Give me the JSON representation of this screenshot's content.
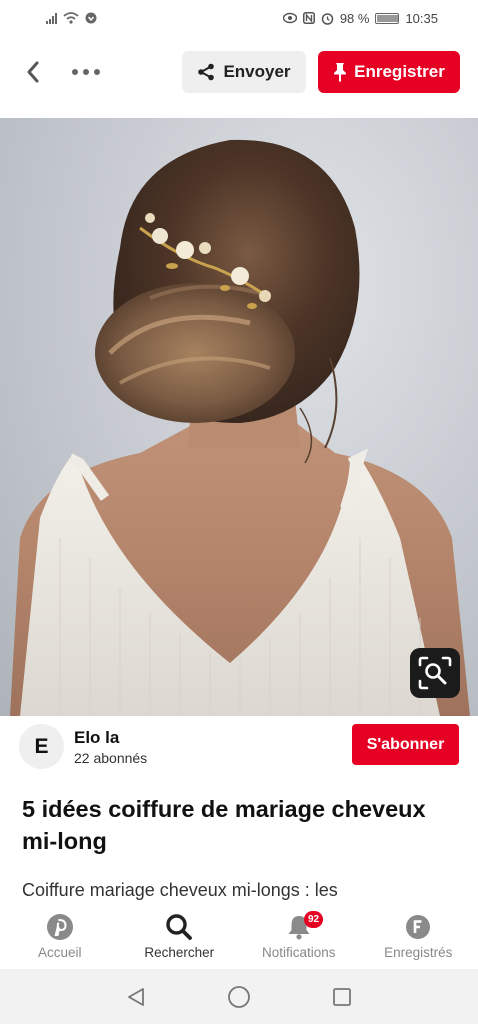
{
  "status_bar": {
    "battery": "98 %",
    "time": "10:35"
  },
  "top_bar": {
    "send_label": "Envoyer",
    "save_label": "Enregistrer"
  },
  "creator": {
    "avatar_letter": "E",
    "name": "Elo la",
    "followers": "22 abonnés",
    "follow_label": "S'abonner"
  },
  "pin": {
    "title": "5 idées coiffure de mariage cheveux mi-long",
    "description": "Coiffure mariage cheveux mi-longs : les"
  },
  "bottom_nav": {
    "items": [
      {
        "label": "Accueil",
        "icon": "pinterest-icon"
      },
      {
        "label": "Rechercher",
        "icon": "search-icon"
      },
      {
        "label": "Notifications",
        "icon": "bell-icon",
        "badge": "92"
      },
      {
        "label": "Enregistrés",
        "icon": "profile-icon"
      }
    ]
  },
  "colors": {
    "accent": "#e60023"
  }
}
